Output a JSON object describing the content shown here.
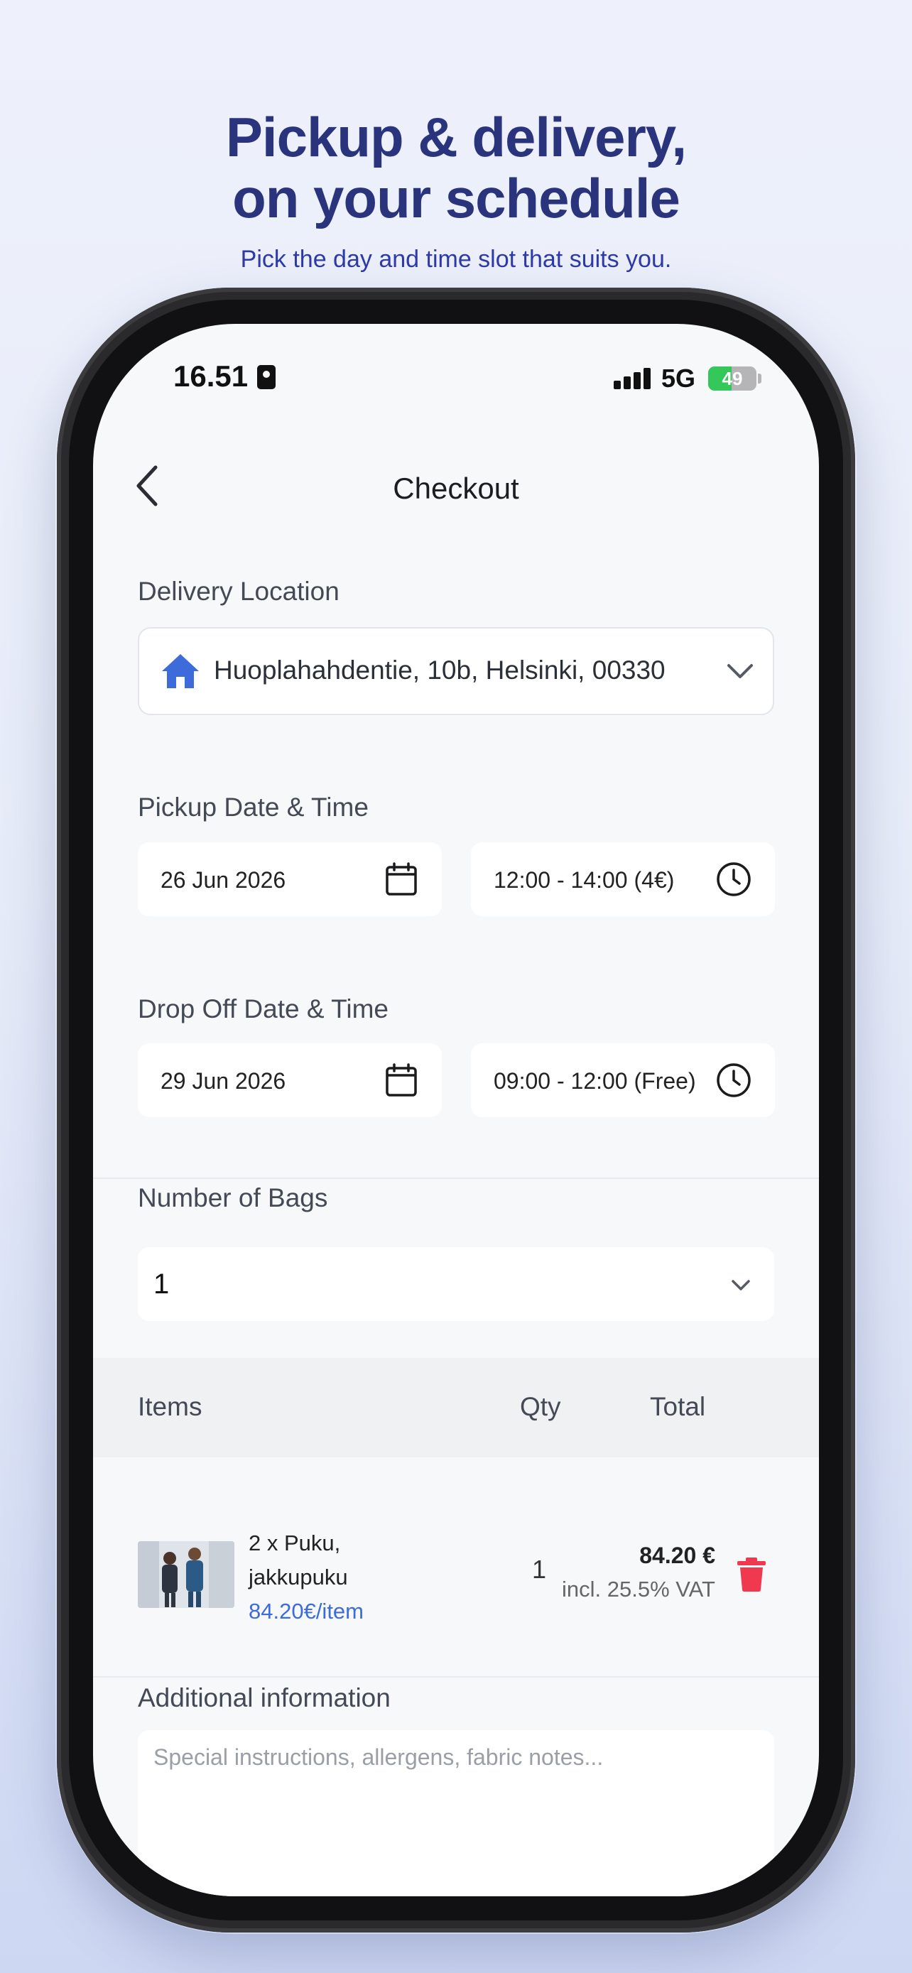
{
  "hero": {
    "title_line1": "Pickup & delivery,",
    "title_line2": "on your schedule",
    "subtitle": "Pick the day and time slot that suits you."
  },
  "status_bar": {
    "time": "16.51",
    "network": "5G",
    "battery": "49",
    "battery_level": 0.49
  },
  "header": {
    "title": "Checkout"
  },
  "delivery": {
    "label": "Delivery Location",
    "address": "Huoplahahdentie, 10b, Helsinki, 00330"
  },
  "pickup": {
    "label": "Pickup Date & Time",
    "date": "26 Jun 2026",
    "time": "12:00 - 14:00 (4€)"
  },
  "dropoff": {
    "label": "Drop Off Date & Time",
    "date": "29 Jun 2026",
    "time": "09:00 - 12:00 (Free)"
  },
  "bags": {
    "label": "Number of Bags",
    "value": "1"
  },
  "table": {
    "headers": {
      "items": "Items",
      "qty": "Qty",
      "total": "Total"
    },
    "rows": [
      {
        "name_line1": "2 x Puku,",
        "name_line2": "jakkupuku",
        "unit_price": "84.20€/item",
        "qty": "1",
        "total": "84.20 €",
        "vat": "incl. 25.5% VAT"
      }
    ]
  },
  "additional": {
    "label": "Additional information",
    "placeholder": "Special instructions, allergens, fabric notes..."
  },
  "colors": {
    "accent": "#3d6bd9",
    "title_blue": "#29347c",
    "delete_red": "#f0384e"
  }
}
